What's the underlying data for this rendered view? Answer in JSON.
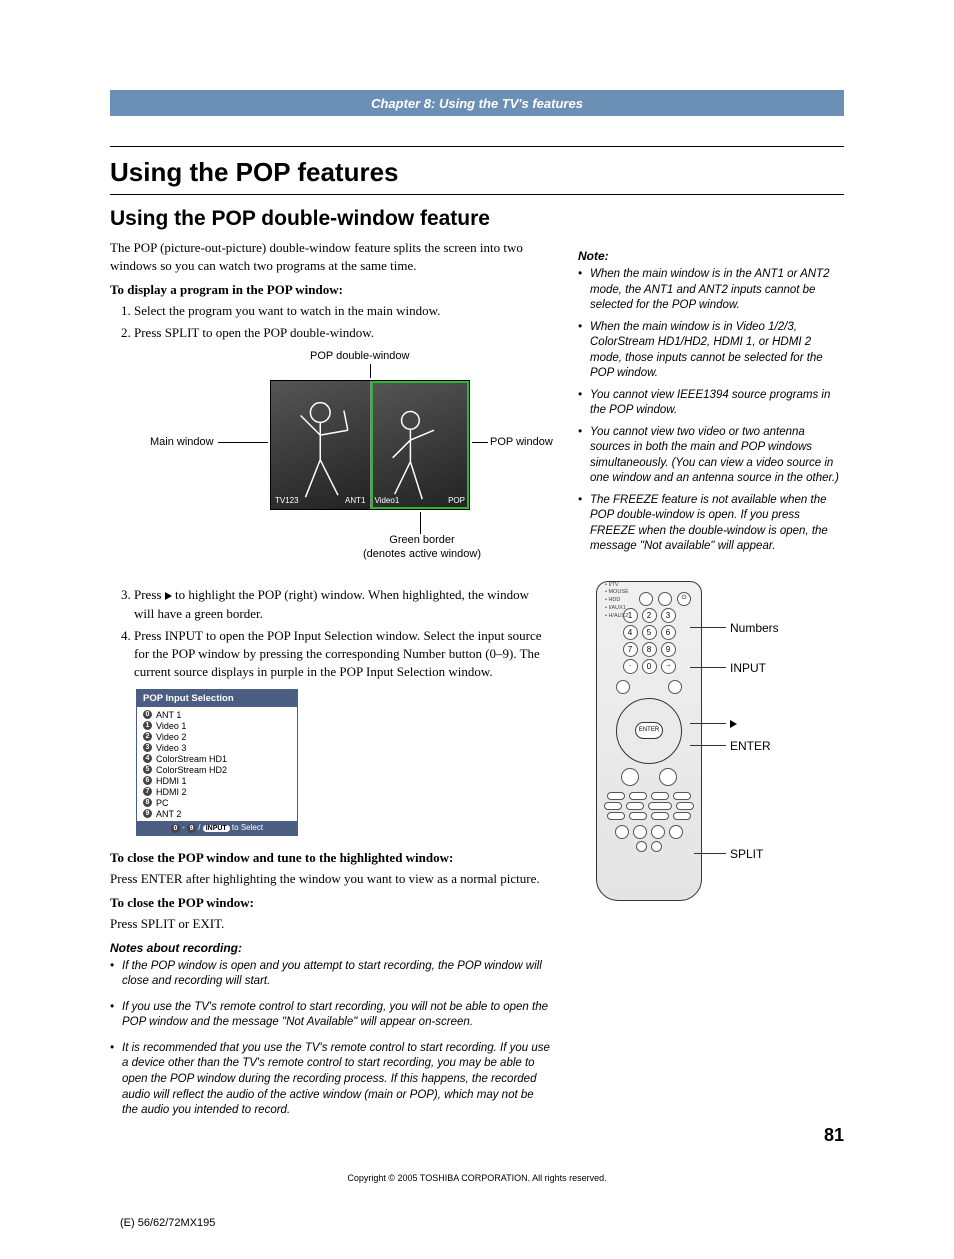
{
  "chapter": "Chapter 8: Using the TV's features",
  "h1": "Using the POP features",
  "h2": "Using the POP double-window feature",
  "intro": "The POP (picture-out-picture) double-window feature splits the screen into two windows so you can watch two programs at the same time.",
  "display_heading": "To display a program in the POP window:",
  "steps_a": {
    "1": "Select the program you want to watch in the main window.",
    "2": "Press SPLIT to open the POP double-window."
  },
  "diagram": {
    "top": "POP double-window",
    "left": "Main window",
    "right": "POP window",
    "tag_left_top": "TV123",
    "tag_left_bottom": "ANT1",
    "tag_right_top": "Video1",
    "tag_right_bottom": "POP",
    "legend1": "Green border",
    "legend2": "(denotes active window)"
  },
  "steps_b": {
    "3": "Press c to highlight the POP (right) window. When highlighted, the window will have a green border.",
    "4": "Press INPUT to open the POP Input Selection window. Select the input source for the POP window by pressing the corresponding Number button (0–9). The current source displays in purple in the POP Input Selection window."
  },
  "input_selection": {
    "title": "POP Input Selection",
    "items": [
      {
        "n": "0",
        "label": "ANT 1"
      },
      {
        "n": "1",
        "label": "Video 1"
      },
      {
        "n": "2",
        "label": "Video 2"
      },
      {
        "n": "3",
        "label": "Video 3"
      },
      {
        "n": "4",
        "label": "ColorStream HD1"
      },
      {
        "n": "5",
        "label": "ColorStream HD2"
      },
      {
        "n": "6",
        "label": "HDMI 1"
      },
      {
        "n": "7",
        "label": "HDMI 2"
      },
      {
        "n": "8",
        "label": "PC"
      },
      {
        "n": "9",
        "label": "ANT 2"
      }
    ],
    "footer_prefix": "0",
    "footer_mid": "9",
    "footer_sep": " - ",
    "footer_slash": " / ",
    "footer_pill": "INPUT",
    "footer_suffix": " to Select"
  },
  "close_highlight_heading": "To close the POP window and tune to the highlighted window:",
  "close_highlight_body": "Press ENTER after highlighting the window you want to view as a normal picture.",
  "close_heading": "To close the POP window:",
  "close_body": "Press SPLIT or EXIT.",
  "recording_heading": "Notes about recording:",
  "recording_notes": [
    "If the POP window is open and you attempt to start recording, the POP window will close and recording will start.",
    "If you use the TV's remote control to start recording, you will not be able to open the POP window and the message \"Not Available\" will appear on-screen.",
    "It is recommended that you use the TV's remote control to start recording. If you use a device other than the TV's remote control to start recording, you may be able to open the POP window during the recording process. If this happens, the recorded audio will reflect the audio of the active window (main or POP), which may not be the audio you intended to record."
  ],
  "side_note_heading": "Note:",
  "side_notes": [
    "When the main window is in the ANT1 or ANT2 mode, the ANT1 and ANT2 inputs cannot be selected for the POP window.",
    "When the main window is in Video 1/2/3, ColorStream HD1/HD2, HDMI 1, or HDMI 2 mode, those inputs cannot be selected for the POP window.",
    "You cannot view IEEE1394 source programs in the POP window.",
    "You cannot view two video or two antenna sources in both the main and POP windows simultaneously. (You can view a video source in one window and an antenna source in the other.)",
    "The FREEZE feature is not available when the POP double-window is open. If you press FREEZE when the double-window is open, the message \"Not available\" will appear."
  ],
  "remote_labels": {
    "numbers": "Numbers",
    "input": "INPUT",
    "right": "c",
    "enter": "ENTER",
    "split": "SPLIT",
    "dpad_center": "ENTER"
  },
  "remote_side": "• I/TV\n• MOUSE\n• HDD\n• I/AUX1\n• H/AUX2",
  "footer": "Copyright © 2005 TOSHIBA CORPORATION. All rights reserved.",
  "page_number": "81",
  "model": "(E) 56/62/72MX195"
}
